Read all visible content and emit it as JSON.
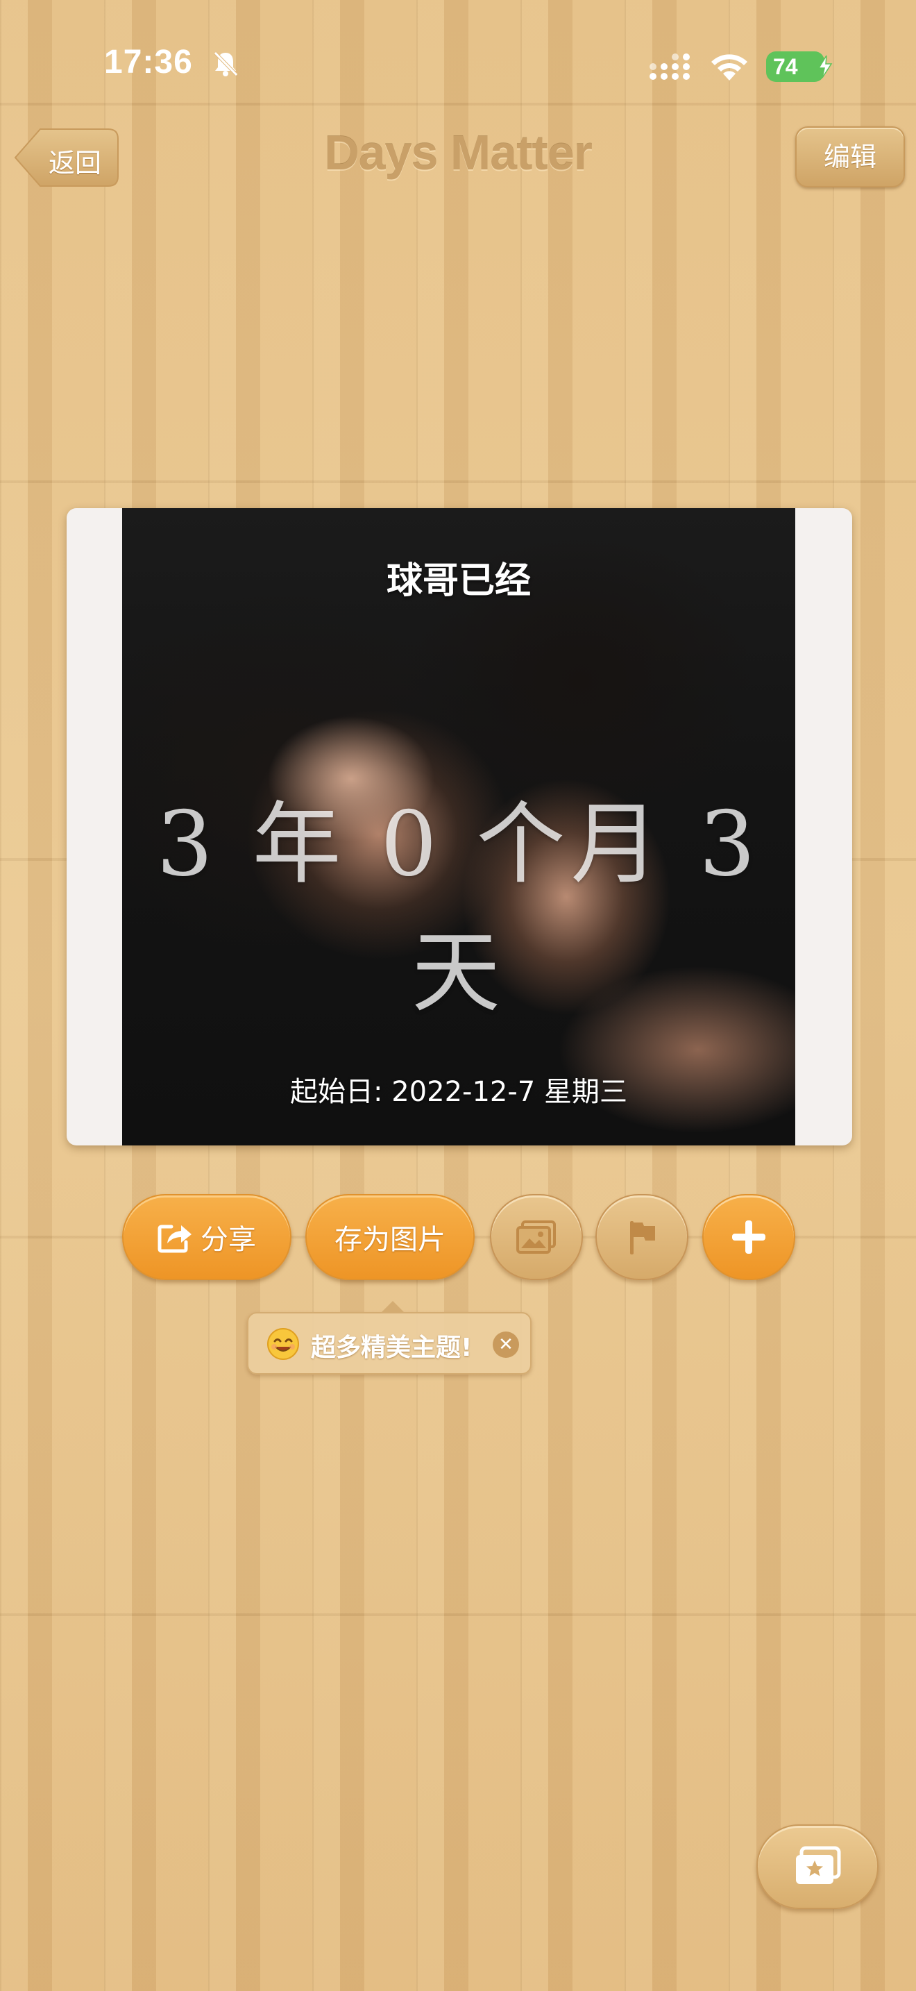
{
  "status_bar": {
    "time": "17:36",
    "battery": "74",
    "icons": [
      "bell-slash-icon",
      "signal-icon",
      "wifi-icon",
      "battery-charging-icon"
    ]
  },
  "nav": {
    "back_label": "返回",
    "title": "Days Matter",
    "edit_label": "编辑"
  },
  "card": {
    "title": "球哥已经",
    "count": "3 年 0 个月 3 天",
    "start_date": "起始日: 2022-12-7 星期三"
  },
  "actions": {
    "share_label": "分享",
    "save_image_label": "存为图片",
    "icons": [
      "share-icon",
      "gallery-icon",
      "flag-icon",
      "plus-icon"
    ]
  },
  "tooltip": {
    "text": "超多精美主题!",
    "icons": [
      "smile-emoji-icon",
      "close-icon"
    ]
  },
  "bottom": {
    "icons": [
      "theme-star-photo-icon"
    ]
  },
  "colors": {
    "accent_orange": "#f0a038",
    "wood": "#e3bd84",
    "title_brown": "#c9a068"
  }
}
